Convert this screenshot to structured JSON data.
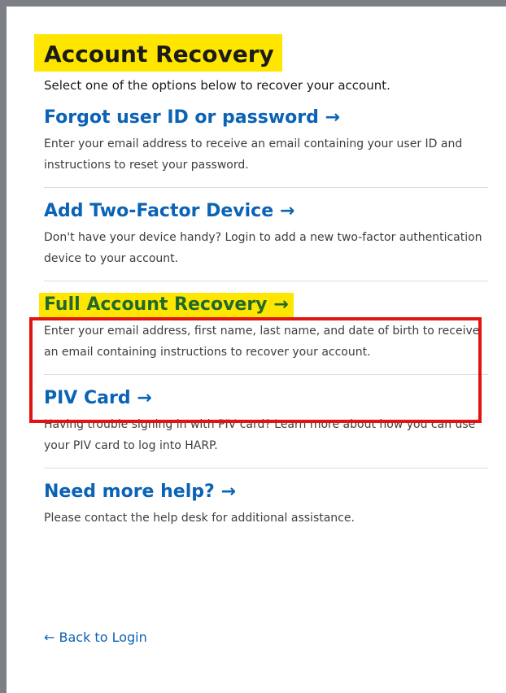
{
  "page": {
    "title": "Account Recovery",
    "subtitle": "Select one of the options below to recover your account."
  },
  "options": [
    {
      "label": "Forgot user ID or password",
      "arrow": "→",
      "description": "Enter your email address to receive an email containing your user ID and instructions to reset your password."
    },
    {
      "label": "Add Two-Factor Device",
      "arrow": "→",
      "description": "Don't have your device handy? Login to add a new two-factor authentication device to your account."
    },
    {
      "label": "Full Account Recovery",
      "arrow": "→",
      "description": "Enter your email address, first name, last name, and date of birth to receive an email containing instructions to recover your account."
    },
    {
      "label": "PIV Card",
      "arrow": "→",
      "description": "Having trouble signing in with PIV card? Learn more about how you can use your PIV card to log into HARP."
    },
    {
      "label": "Need more help?",
      "arrow": "→",
      "description": "Please contact the help desk for additional assistance."
    }
  ],
  "back_link": {
    "arrow": "←",
    "label": "Back to Login"
  },
  "colors": {
    "highlight_yellow": "#ffe600",
    "link_blue": "#0b63b5",
    "highlight_text_green": "#1f6a2b",
    "annotation_red": "#e2140f",
    "frame_gray": "#7c7f83"
  },
  "icons": {
    "option_arrow": "arrow-right-icon",
    "back_arrow": "arrow-left-icon"
  }
}
